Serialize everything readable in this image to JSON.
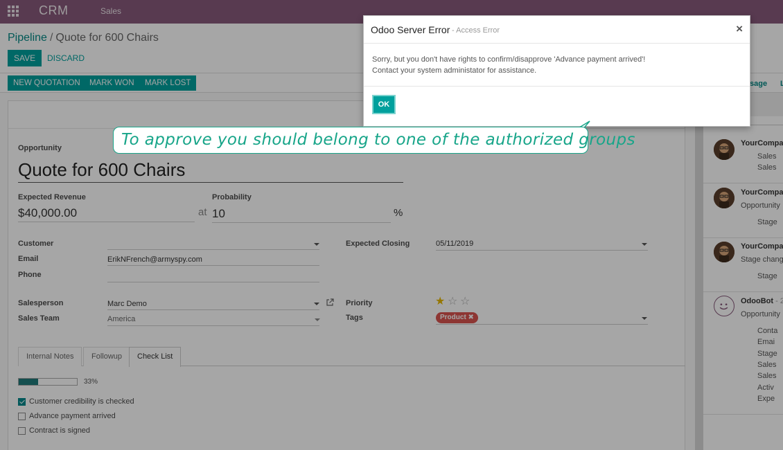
{
  "topbar": {
    "brand": "CRM",
    "menu_sales": "Sales"
  },
  "breadcrumb": {
    "parent": "Pipeline",
    "separator": "/",
    "current": "Quote for 600 Chairs"
  },
  "actions": {
    "save": "SAVE",
    "discard": "DISCARD"
  },
  "statusbar": {
    "new_quotation": "NEW QUOTATION",
    "mark_won": "MARK WON",
    "mark_lost": "MARK LOST"
  },
  "form": {
    "opportunity_label": "Opportunity",
    "opportunity_name": "Quote for 600 Chairs",
    "expected_revenue_label": "Expected Revenue",
    "expected_revenue": "$40,000.00",
    "at": "at",
    "probability_label": "Probability",
    "probability": "10",
    "percent": "%",
    "customer_label": "Customer",
    "customer": "",
    "email_label": "Email",
    "email": "ErikNFrench@armyspy.com",
    "phone_label": "Phone",
    "phone": "",
    "expected_closing_label": "Expected Closing",
    "expected_closing": "05/11/2019",
    "salesperson_label": "Salesperson",
    "salesperson": "Marc Demo",
    "sales_team_label": "Sales Team",
    "sales_team": "America",
    "priority_label": "Priority",
    "priority_stars": 1,
    "priority_max": 3,
    "tags_label": "Tags",
    "tag": "Product ✖"
  },
  "tabs": [
    {
      "label": "Internal Notes"
    },
    {
      "label": "Followup"
    },
    {
      "label": "Check List"
    }
  ],
  "checklist": {
    "progress_percent": 33,
    "progress_text": "33%",
    "items": [
      {
        "label": "Customer credibility is checked",
        "checked": true
      },
      {
        "label": "Advance payment arrived",
        "checked": false
      },
      {
        "label": "Contract is signed",
        "checked": false
      }
    ]
  },
  "chatter": {
    "send_message": "sage",
    "send_l": "L",
    "messages": [
      {
        "author": "YourCompan",
        "lines": [],
        "bullets": [
          "Sales",
          "Sales"
        ]
      },
      {
        "author": "YourCompar",
        "lines": [
          "Opportunity"
        ],
        "bullets": [
          "Stage"
        ]
      },
      {
        "author": "YourCompar",
        "lines": [
          "Stage chang"
        ],
        "bullets": [
          "Stage"
        ]
      },
      {
        "author": "OdooBot",
        "author_suffix": " - 2",
        "lines": [
          "Opportunity"
        ],
        "bullets": [
          "Conta",
          "Emai",
          "Stage",
          "Sales",
          "Sales",
          "Activ",
          "Expe"
        ]
      }
    ]
  },
  "dialog": {
    "title": "Odoo Server Error",
    "subtitle": "- Access Error",
    "close": "×",
    "message_line1": "Sorry, but you don't have rights to confirm/disapprove 'Advance payment arrived'!",
    "message_line2": "Contact your system administator for assistance.",
    "ok": "OK"
  },
  "callout": {
    "text": "To approve you should belong to one of the authorized groups"
  },
  "colors": {
    "topbar": "#875a7b",
    "primary": "#00a09d",
    "callout": "#17a589",
    "tag": "#d9534f"
  }
}
